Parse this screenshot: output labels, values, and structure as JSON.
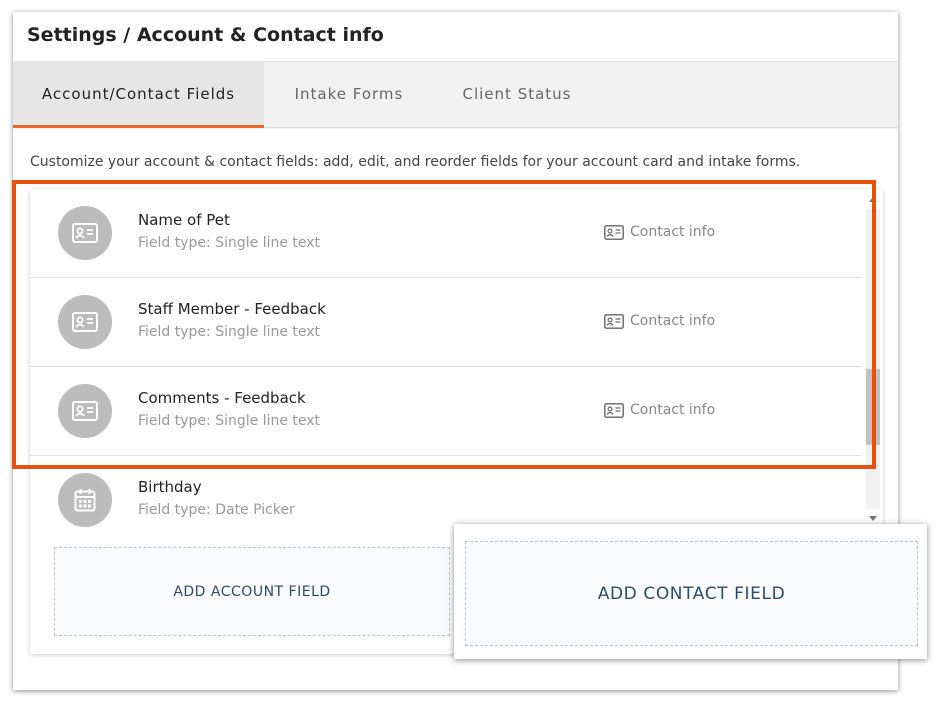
{
  "header": {
    "title": "Settings / Account & Contact info"
  },
  "tabs": [
    {
      "label": "Account/Contact Fields",
      "active": true
    },
    {
      "label": "Intake Forms",
      "active": false
    },
    {
      "label": "Client Status",
      "active": false
    }
  ],
  "description": "Customize your account & contact fields: add, edit, and reorder fields for your account card and intake forms.",
  "fields": [
    {
      "title": "Name of Pet",
      "type": "Field type: Single line text",
      "category": "Contact info",
      "icon": "contact-card-icon"
    },
    {
      "title": "Staff Member - Feedback",
      "type": "Field type: Single line text",
      "category": "Contact info",
      "icon": "contact-card-icon"
    },
    {
      "title": "Comments - Feedback",
      "type": "Field type: Single line text",
      "category": "Contact info",
      "icon": "contact-card-icon"
    },
    {
      "title": "Birthday",
      "type": "Field type: Date Picker",
      "category": "",
      "icon": "calendar-icon"
    }
  ],
  "actions": {
    "add_account_label": "ADD ACCOUNT FIELD",
    "add_contact_label": "ADD CONTACT FIELD"
  },
  "colors": {
    "accent": "#e8642a",
    "highlight": "#e8500e",
    "action_text": "#2d4c6b",
    "avatar": "#bcbcbc"
  }
}
